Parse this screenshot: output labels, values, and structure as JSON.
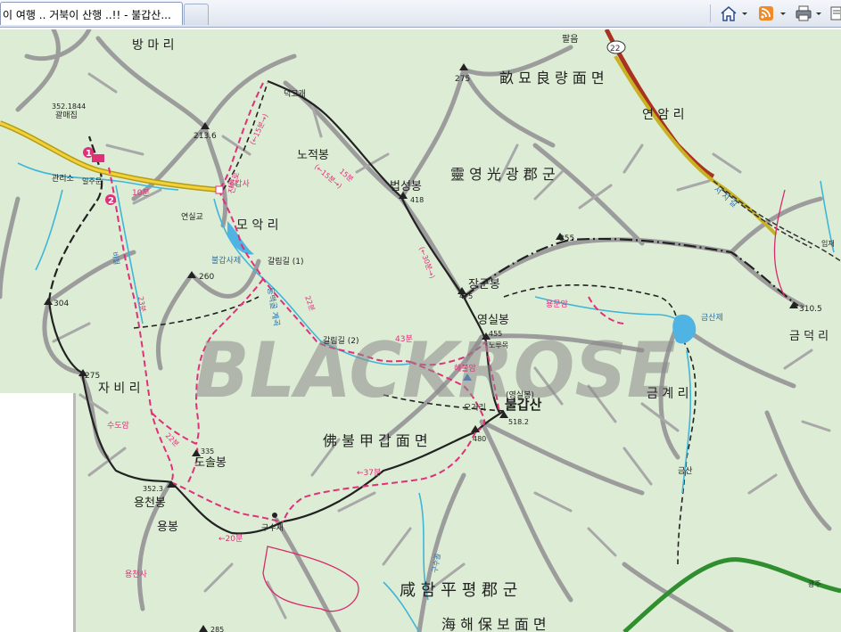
{
  "browser": {
    "tab_title": "이 여행 .. 거북이 산행 ..!! - 불갑산...",
    "icons": [
      "home-icon",
      "rss-feed-icon",
      "print-icon",
      "page-icon"
    ]
  },
  "map": {
    "watermark": "BLACKROSE",
    "road_number": "22",
    "labels": {
      "bangmari": "방 마 리",
      "palgeum": "팔음",
      "h275a": "275",
      "myoryangmyeon": "畝 묘 良 량 面 면",
      "yeonamri": "연 암 리",
      "deokgogae": "덕고개",
      "h2136": "213.6",
      "h3521844": "352.1844",
      "gwaemae": "괄매집",
      "gwanriso": "관리소",
      "iljumun": "일주문",
      "nojeokbong": "노적봉",
      "beopseongbong": "법성봉",
      "h418": "418",
      "yeonggwanggun": "靈 영 光 광 郡 군",
      "bulgapsa": "불갑사",
      "yeonsilgyo": "연실교",
      "moakri": "모 악 리",
      "bulgapsajae": "불갑사제",
      "galrimgil1": "갈림길 (1)",
      "h260": "260",
      "h304": "304",
      "h355": "355",
      "janggunbong": "장군봉",
      "h475": "475",
      "yongmunam": "용문암",
      "geumsanje": "금산제",
      "h3105": "310.5",
      "geumdeokri": "금 덕 리",
      "yeongsilbong": "영실봉",
      "h455": "455",
      "norumok": "노루목",
      "galrimgil2": "갈림길 (2)",
      "haebulam": "해불암",
      "h275b": "275",
      "jabiri": "자 비 리",
      "yeongsilbong2": "(영실봉)",
      "bulgapsan": "불갑산",
      "h5182": "518.2",
      "ogeori": "오거리",
      "h480": "480",
      "geumgyeri": "금 계 리",
      "sudoam": "수도암",
      "h335": "335",
      "doseolbong": "도솔봉",
      "bulgapmyeon": "佛 불 甲 갑 面 면",
      "h3523": "352.3",
      "yongcheonbong": "용천봉",
      "yongbong": "용봉",
      "gusujae": "구수재",
      "geumsan": "금산",
      "yongcheonsa": "용천사",
      "hampyeonggun": "咸 함 平 평 郡 군",
      "haebomyeon": "海 해 保 보 面 면",
      "h285": "285",
      "gwangju": "광주",
      "seojigil": "서 치 길",
      "imjae": "임재",
      "t10": "10분",
      "t15a": "(←15분→)",
      "t15b": "(←15분→)",
      "t30": "(←30분→)",
      "t22a": "22분",
      "t23": "23분",
      "t22b": "22분",
      "t43": "43분",
      "t37": "←37분",
      "t20": "←20분",
      "jinip": "진입로",
      "dunggol": "동백골 계곡",
      "t15gil": "15분",
      "waman": "비월",
      "guryeong": "구수골"
    }
  }
}
